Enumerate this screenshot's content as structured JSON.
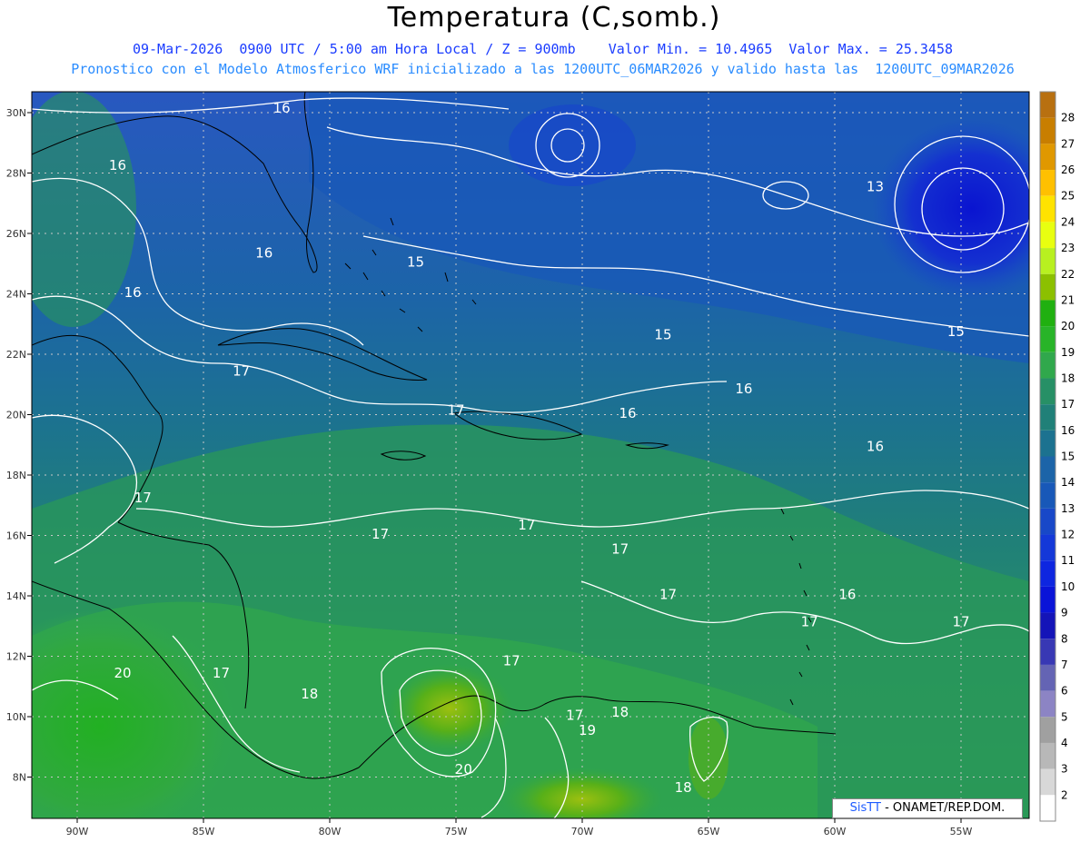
{
  "header": {
    "title": "Temperatura (C,somb.)",
    "line1": "09-Mar-2026  0900 UTC / 5:00 am Hora Local / Z = 900mb    Valor Min. = 10.4965  Valor Max. = 25.3458",
    "line2": "Pronostico con el Modelo Atmosferico WRF inicializado a las 1200UTC_06MAR2026 y valido hasta las  1200UTC_09MAR2026"
  },
  "map": {
    "lon_labels": [
      "90W",
      "85W",
      "80W",
      "75W",
      "70W",
      "65W",
      "60W",
      "55W"
    ],
    "lat_labels": [
      "30N",
      "28N",
      "26N",
      "24N",
      "22N",
      "20N",
      "18N",
      "16N",
      "14N",
      "12N",
      "10N",
      "8N"
    ],
    "contour_labels": [
      {
        "text": "16",
        "lon": -81.9,
        "lat": 30.0
      },
      {
        "text": "16",
        "lon": -88.4,
        "lat": 28.1
      },
      {
        "text": "16",
        "lon": -82.6,
        "lat": 25.2
      },
      {
        "text": "16",
        "lon": -87.8,
        "lat": 23.9
      },
      {
        "text": "15",
        "lon": -76.6,
        "lat": 24.9
      },
      {
        "text": "13",
        "lon": -58.4,
        "lat": 27.4
      },
      {
        "text": "15",
        "lon": -66.8,
        "lat": 22.5
      },
      {
        "text": "15",
        "lon": -55.2,
        "lat": 22.6
      },
      {
        "text": "16",
        "lon": -63.6,
        "lat": 20.7
      },
      {
        "text": "16",
        "lon": -68.2,
        "lat": 19.9
      },
      {
        "text": "16",
        "lon": -58.4,
        "lat": 18.8
      },
      {
        "text": "17",
        "lon": -83.5,
        "lat": 21.3
      },
      {
        "text": "17",
        "lon": -75.0,
        "lat": 20.0
      },
      {
        "text": "17",
        "lon": -87.4,
        "lat": 17.1
      },
      {
        "text": "17",
        "lon": -78.0,
        "lat": 15.9
      },
      {
        "text": "17",
        "lon": -72.2,
        "lat": 16.2
      },
      {
        "text": "17",
        "lon": -68.5,
        "lat": 15.4
      },
      {
        "text": "17",
        "lon": -66.6,
        "lat": 13.9
      },
      {
        "text": "16",
        "lon": -59.5,
        "lat": 13.9
      },
      {
        "text": "17",
        "lon": -61.0,
        "lat": 13.0
      },
      {
        "text": "17",
        "lon": -55.0,
        "lat": 13.0
      },
      {
        "text": "17",
        "lon": -72.8,
        "lat": 11.7
      },
      {
        "text": "17",
        "lon": -84.3,
        "lat": 11.3
      },
      {
        "text": "20",
        "lon": -88.2,
        "lat": 11.3
      },
      {
        "text": "18",
        "lon": -80.8,
        "lat": 10.6
      },
      {
        "text": "17",
        "lon": -70.3,
        "lat": 9.9
      },
      {
        "text": "18",
        "lon": -68.5,
        "lat": 10.0
      },
      {
        "text": "19",
        "lon": -69.8,
        "lat": 9.4
      },
      {
        "text": "20",
        "lon": -74.7,
        "lat": 8.1
      },
      {
        "text": "18",
        "lon": -66.0,
        "lat": 7.5
      }
    ]
  },
  "colorbar": {
    "levels": [
      "28",
      "27",
      "26",
      "25",
      "24",
      "23",
      "22",
      "21",
      "20",
      "19",
      "18",
      "17",
      "16",
      "15",
      "14",
      "13",
      "12",
      "11",
      "10",
      "9",
      "8",
      "7",
      "6",
      "5",
      "4",
      "3",
      "2"
    ],
    "colors": [
      "#c87e00",
      "#e09800",
      "#ffc000",
      "#ffe300",
      "#e8ff10",
      "#b8f020",
      "#8cc000",
      "#20b010",
      "#28b428",
      "#30a84c",
      "#279066",
      "#208078",
      "#1c7290",
      "#1c64a8",
      "#1858b8",
      "#1848c8",
      "#1438d8",
      "#0e26e0",
      "#0a14d8",
      "#1414b8",
      "#3838b4",
      "#6464b4",
      "#8c84c4",
      "#a0a0a0",
      "#b8b8b8",
      "#d8d8d8",
      "#ffffff"
    ],
    "top_color": "#b87010"
  },
  "credit": {
    "sis": "SisTT",
    "org": "- ONAMET/REP.DOM."
  }
}
